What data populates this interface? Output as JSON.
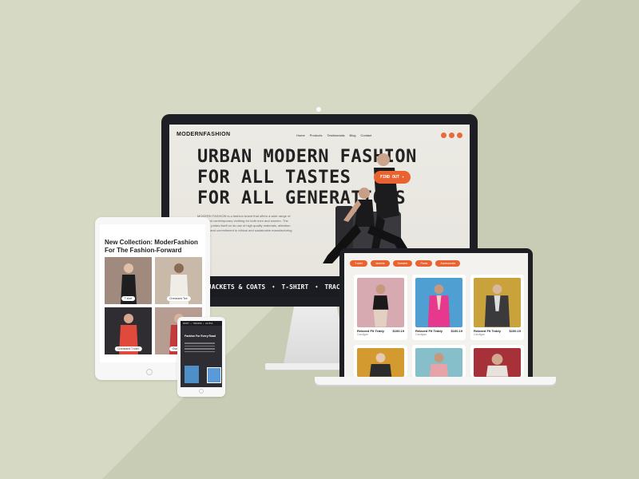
{
  "desktop": {
    "logo": "MODERNFASHION",
    "nav": [
      "Home",
      "Products",
      "Testimonials",
      "Blog",
      "Contact"
    ],
    "social_icons": [
      "instagram-icon",
      "dribbble-icon",
      "facebook-icon"
    ],
    "hero_lines": [
      "URBAN MODERN FASHION",
      "FOR ALL TASTES",
      "FOR ALL GENERATIONS"
    ],
    "cta": "FIND OUT",
    "paragraph": "MODERN FASHION is a fashion brand that offers a wide range of stylish and contemporary clothing for both men and women. The company prides itself on its use of high quality materials, attention to detail, and commitment to ethical and sustainable manufacturing practices.",
    "categories": [
      "JACKETS & COATS",
      "T-SHIRT",
      "TRAC"
    ]
  },
  "laptop": {
    "filters": [
      "T-shirt",
      "Jackets",
      "Sweater",
      "Pants",
      "Accessories"
    ],
    "products": [
      {
        "name": "Relaxed Fit Teddy",
        "price": "$100.19",
        "sub": "Cardigan",
        "bg": "#d7a9b1"
      },
      {
        "name": "Relaxed Fit Teddy",
        "price": "$100.19",
        "sub": "Cardigan",
        "bg": "#4f9fd2"
      },
      {
        "name": "Relaxed Fit Teddy",
        "price": "$100.19",
        "sub": "Cardigan",
        "bg": "#c9a23c"
      },
      {
        "name": "",
        "price": "",
        "sub": "",
        "bg": "#d39a2f"
      },
      {
        "name": "",
        "price": "",
        "sub": "",
        "bg": "#86bfc9"
      },
      {
        "name": "",
        "price": "",
        "sub": "",
        "bg": "#a63138"
      }
    ]
  },
  "tablet": {
    "title": "New Collection: ModerFashion For The Fashion-Forward",
    "tiles": [
      {
        "label": "T-shirt",
        "bg": "#a08a7e"
      },
      {
        "label": "Oversized Tee",
        "bg": "#c9b9a8"
      },
      {
        "label": "Oversized T-shirt",
        "bg": "#2f2d32"
      },
      {
        "label": "Oversized",
        "bg": "#b79c92"
      }
    ]
  },
  "phone": {
    "top_bar": "SHIRT ✦ TROUSER ✦ ACCESS",
    "headline": "Fashion For Every Road"
  },
  "colors": {
    "background": "#d6dac4",
    "accent": "#e9622f",
    "device_dark": "#1e1f24"
  }
}
